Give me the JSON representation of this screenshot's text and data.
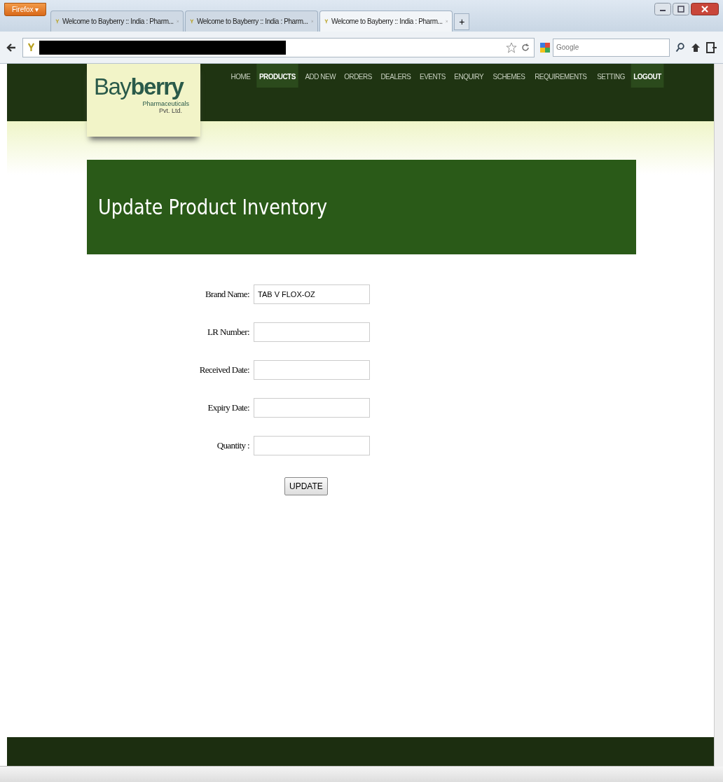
{
  "browser": {
    "menu_button": "Firefox",
    "menu_caret": "▾",
    "tabs": [
      {
        "label": "Welcome to Bayberry :: India : Pharm...",
        "selected": false
      },
      {
        "label": "Welcome to Bayberry :: India : Pharm...",
        "selected": false
      },
      {
        "label": "Welcome to Bayberry :: India : Pharm...",
        "selected": true
      }
    ],
    "new_tab": "+",
    "search": {
      "placeholder": "Google"
    }
  },
  "logo": {
    "name": "Bay**berry**",
    "line_1": "Pharmaceuticals",
    "line_2": "Pvt. Ltd."
  },
  "nav": [
    {
      "label": "HOME",
      "highlighted": false
    },
    {
      "label": "PRODUCTS",
      "highlighted": true
    },
    {
      "label": "ADD NEW",
      "highlighted": false
    },
    {
      "label": "ORDERS",
      "highlighted": false
    },
    {
      "label": "DEALERS",
      "highlighted": false
    },
    {
      "label": "EVENTS",
      "highlighted": false
    },
    {
      "label": "ENQUIRY",
      "highlighted": false
    },
    {
      "label": "SCHEMES",
      "highlighted": false
    },
    {
      "label": "REQUIREMENTS",
      "highlighted": false
    },
    {
      "label": "SETTING",
      "highlighted": false
    },
    {
      "label": "LOGOUT",
      "highlighted": true
    }
  ],
  "page_title": "Update Product Inventory",
  "form": {
    "fields": [
      {
        "label": "Brand Name:",
        "value": "TAB V FLOX-OZ"
      },
      {
        "label": "LR Number:"
      },
      {
        "label": "Received Date:"
      },
      {
        "label": "Expiry Date:"
      },
      {
        "label": "Quantity :"
      }
    ],
    "submit": "UPDATE"
  }
}
